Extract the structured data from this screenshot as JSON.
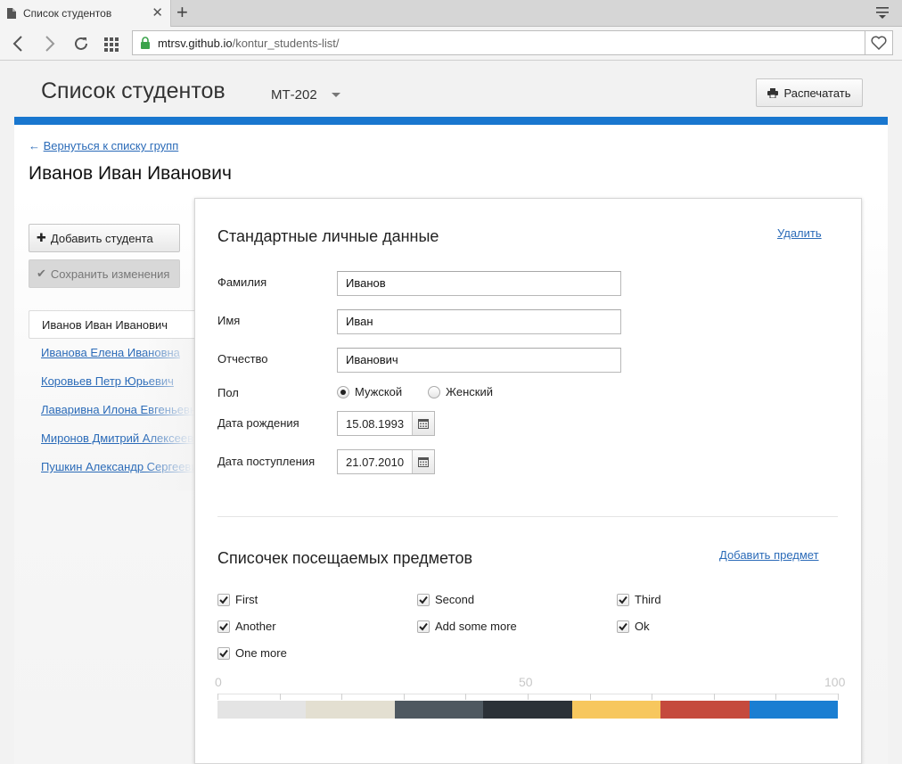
{
  "browser": {
    "tab_title": "Список студентов",
    "url_host": "mtrsv.github.io",
    "url_path": "/kontur_students-list/"
  },
  "header": {
    "title": "Список студентов",
    "group": "МТ-202",
    "print_label": "Распечатать"
  },
  "back_link": "Вернуться к списку групп",
  "student_name": "Иванов Иван Иванович",
  "sidebar": {
    "add_label": "Добавить студента",
    "save_label": "Сохранить изменения",
    "students": [
      "Иванов Иван Иванович",
      "Иванова Елена Ивановна",
      "Коровьев Петр Юрьевич",
      "Лаваривна Илона Евгеньевна",
      "Миронов Дмитрий Алексеевич",
      "Пушкин Александр Сергеевич"
    ],
    "active_index": 0
  },
  "personal": {
    "title": "Стандартные личные данные",
    "delete_label": "Удалить",
    "surname_label": "Фамилия",
    "surname_value": "Иванов",
    "name_label": "Имя",
    "name_value": "Иван",
    "patronymic_label": "Отчество",
    "patronymic_value": "Иванович",
    "gender_label": "Пол",
    "gender_male": "Мужской",
    "gender_female": "Женский",
    "gender_selected": "male",
    "birth_label": "Дата рождения",
    "birth_value": "15.08.1993",
    "enroll_label": "Дата поступления",
    "enroll_value": "21.07.2010"
  },
  "subjects": {
    "title": "Списочек посещаемых предметов",
    "add_label": "Добавить предмет",
    "items": [
      {
        "label": "First",
        "checked": true
      },
      {
        "label": "Second",
        "checked": true
      },
      {
        "label": "Third",
        "checked": true
      },
      {
        "label": "Another",
        "checked": true
      },
      {
        "label": "Add some more",
        "checked": true
      },
      {
        "label": "Ok",
        "checked": true
      },
      {
        "label": "One more",
        "checked": true
      }
    ]
  },
  "scale": {
    "labels": [
      "0",
      "50",
      "100"
    ],
    "segment_colors": [
      "#e4e4e4",
      "#e3dfd1",
      "#4e5860",
      "#2b3137",
      "#f7c75e",
      "#c54a3d",
      "#1a7ed2"
    ]
  }
}
